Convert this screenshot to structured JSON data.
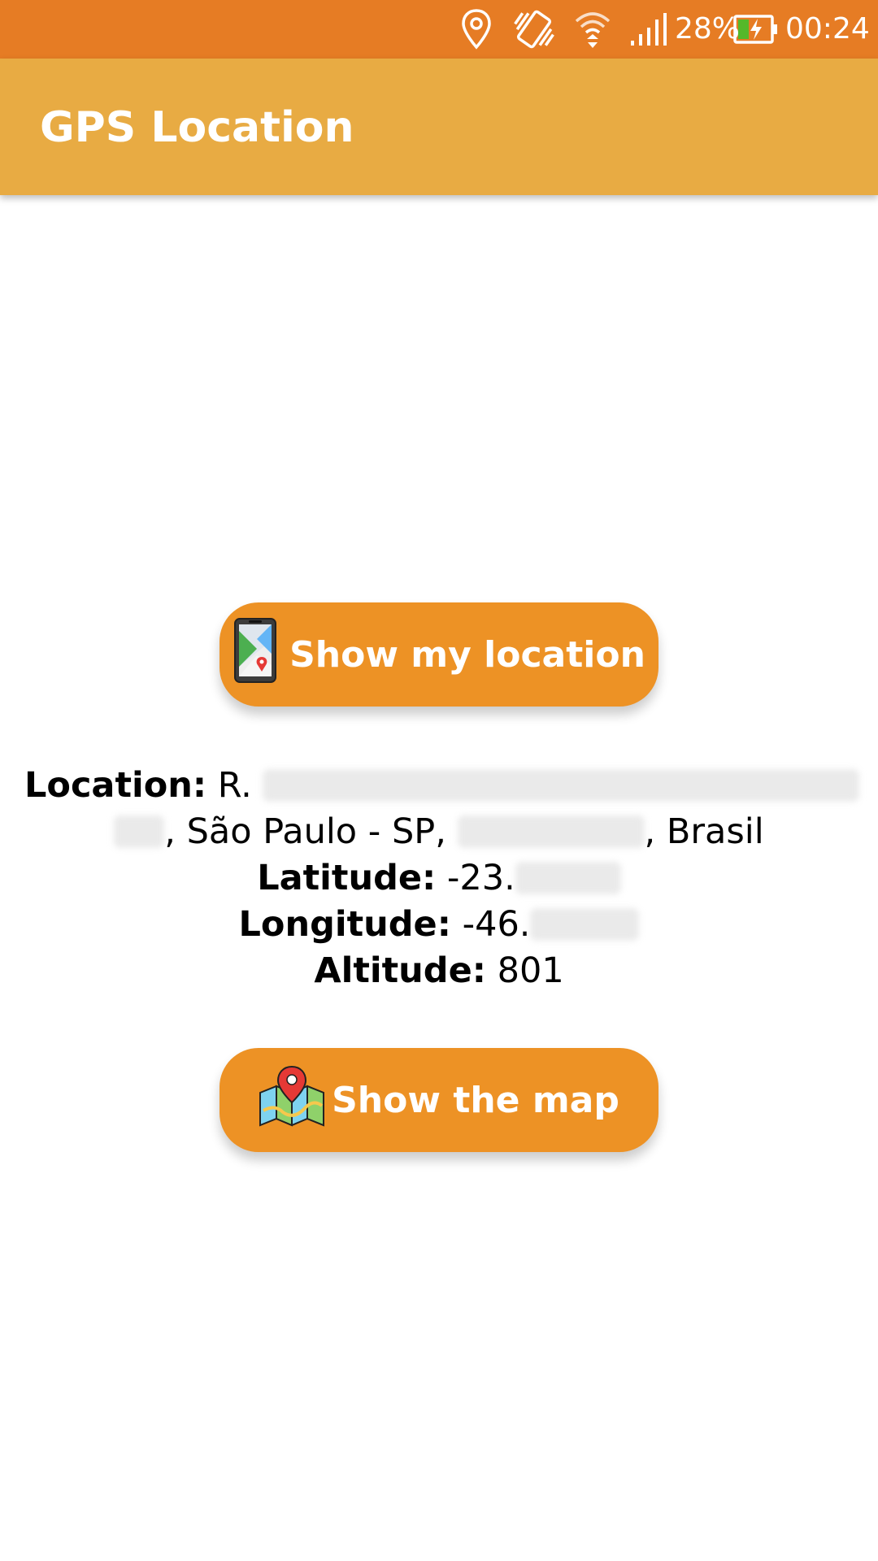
{
  "status_bar": {
    "battery_percent": "28%",
    "time": "00:24",
    "icons": [
      "location-icon",
      "vibrate-icon",
      "wifi-icon",
      "signal-icon",
      "battery-charging-icon"
    ],
    "background": "#e67c24"
  },
  "app_bar": {
    "title": "GPS Location",
    "background": "#e8ab43"
  },
  "buttons": {
    "show_location": {
      "label": "Show my location",
      "icon": "phone-map-icon"
    },
    "show_map": {
      "label": "Show the map",
      "icon": "folded-map-pin-icon"
    },
    "color": "#ed9225"
  },
  "info": {
    "location_label": "Location:",
    "location_prefix": "R.",
    "location_middle": ", São Paulo - SP,",
    "location_suffix": ", Brasil",
    "latitude_label": "Latitude:",
    "latitude_value": "-23.",
    "longitude_label": "Longitude:",
    "longitude_value": "-46.",
    "altitude_label": "Altitude:",
    "altitude_value": "801"
  }
}
